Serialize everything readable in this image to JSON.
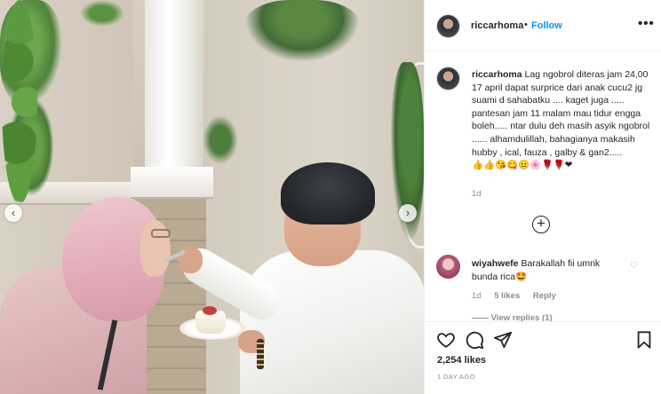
{
  "post": {
    "username": "riccarhoma",
    "separator": "•",
    "follow_label": "Follow",
    "more_label": "•••",
    "caption_user": "riccarhoma",
    "caption": "Lag ngobrol diteras jam 24,00 17 april dapat surprice dari anak cucu2 jg suami d sahabatku .... kaget juga ..... pantesan jam 11 malam mau tidur engga boleh..... ntar dulu deh masih asyik ngobrol ...... alhamdulillah, bahagianya makasih hubby , ical, fauza , galby & gan2.....",
    "caption_emojis": "👍👍😘😋😐🌸🌹🌹❤",
    "caption_time": "1d",
    "load_more_label": "+",
    "likes_text": "2,254 likes",
    "posted_ago": "1 DAY AGO",
    "image_nav_prev": "‹",
    "image_nav_next": "›"
  },
  "comments": [
    {
      "user": "wiyahwefe",
      "text": "Barakallah fii umrik bunda rica🤩",
      "time": "1d",
      "likes": "5 likes",
      "reply_label": "Reply",
      "heart": "♡",
      "view_replies": "—— View replies (1)"
    }
  ],
  "icons": [
    "more-options-icon",
    "add-comment-icon",
    "like-heart-icon",
    "comment-icon",
    "share-icon",
    "save-bookmark-icon",
    "prev-image-icon",
    "next-image-icon"
  ],
  "colors": {
    "follow_blue": "#0095f6",
    "muted_text": "#8e8e8e",
    "primary_text": "#262626"
  }
}
